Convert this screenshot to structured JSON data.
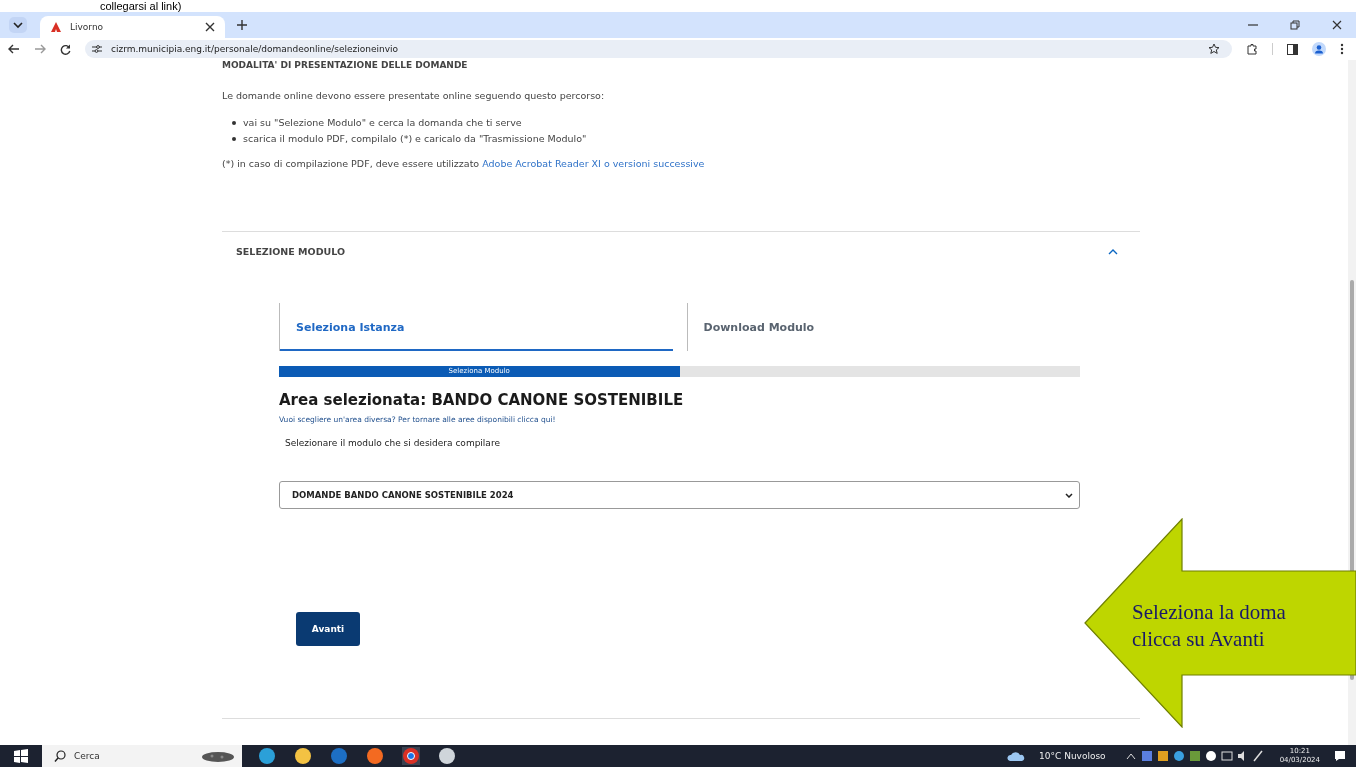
{
  "document_caption": "collegarsi al link)",
  "browser": {
    "tab_title": "Livorno",
    "url": "cizrm.municipia.eng.it/personale/domandeonline/selezioneinvio"
  },
  "page": {
    "section_heading": "MODALITA' DI PRESENTAZIONE DELLE DOMANDE",
    "intro": "Le domande online devono essere presentate online seguendo questo percorso:",
    "bullets": [
      "vai su \"Selezione Modulo\" e cerca la domanda che ti serve",
      "scarica il modulo PDF, compilalo (*) e caricalo da \"Trasmissione Modulo\""
    ],
    "note": {
      "text": "(*) in caso di compilazione PDF, deve essere utilizzato",
      "link": "Adobe Acrobat Reader XI o versioni successive"
    },
    "accordion": {
      "title": "SELEZIONE MODULO",
      "expanded": true
    },
    "steps": [
      {
        "label": "Seleziona Istanza",
        "selected": true
      },
      {
        "label": "Download Modulo",
        "selected": false
      }
    ],
    "progress": {
      "label": "Seleziona Modulo",
      "level": 0.5
    },
    "area_title": "Area selezionata: BANDO CANONE SOSTENIBILE",
    "change_area_link": "Vuoi scegliere un'area diversa? Per tornare alle aree disponibili clicca qui!",
    "select_label": "Selezionare il modulo che si desidera compilare",
    "select_value": "DOMANDE BANDO CANONE SOSTENIBILE 2024",
    "button": "Avanti"
  },
  "callout": {
    "lines": [
      "Seleziona la doma",
      "clicca su Avanti"
    ]
  },
  "taskbar": {
    "search": "Cerca",
    "weather": "10°C Nuvoloso",
    "time": "10:21",
    "date": "04/03/2024"
  }
}
